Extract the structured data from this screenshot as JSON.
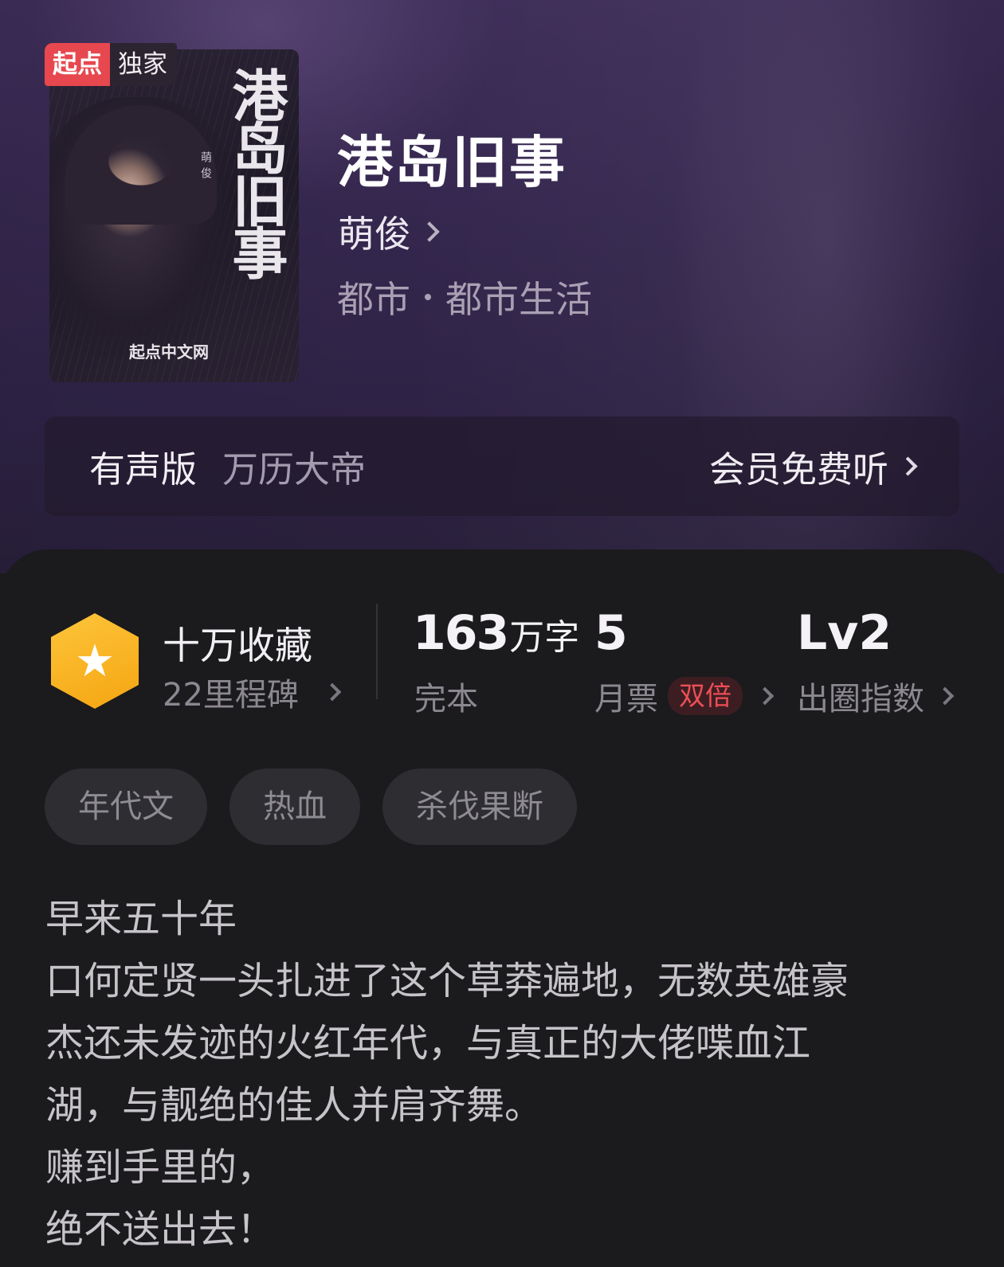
{
  "badge": {
    "brand": "起点",
    "label": "独家"
  },
  "cover": {
    "title": "港岛旧事",
    "author": "萌俊",
    "publisher": "起点中文网"
  },
  "book": {
    "title": "港岛旧事",
    "author": "萌俊",
    "genre_main": "都市",
    "genre_sub": "都市生活"
  },
  "audio": {
    "label": "有声版",
    "narrator": "万历大帝",
    "cta": "会员免费听"
  },
  "stats": {
    "collect_title": "十万收藏",
    "collect_sub": "22里程碑",
    "words_num": "163",
    "words_unit": "万字",
    "status": "完本",
    "monthly_votes": "5",
    "monthly_label": "月票",
    "double_badge": "双倍",
    "level": "Lv2",
    "level_label": "出圈指数"
  },
  "tags": [
    "年代文",
    "热血",
    "杀伐果断"
  ],
  "intro": [
    "早来五十年",
    "口何定贤一头扎进了这个草莽遍地，无数英雄豪",
    "杰还未发迹的火红年代，与真正的大佬喋血江",
    "湖，与靓绝的佳人并肩齐舞。",
    "赚到手里的，",
    "绝不送出去！"
  ],
  "colors": {
    "accent_gold": "#f5a512",
    "badge_red": "#e7474e",
    "double_red": "#ee4e56"
  }
}
